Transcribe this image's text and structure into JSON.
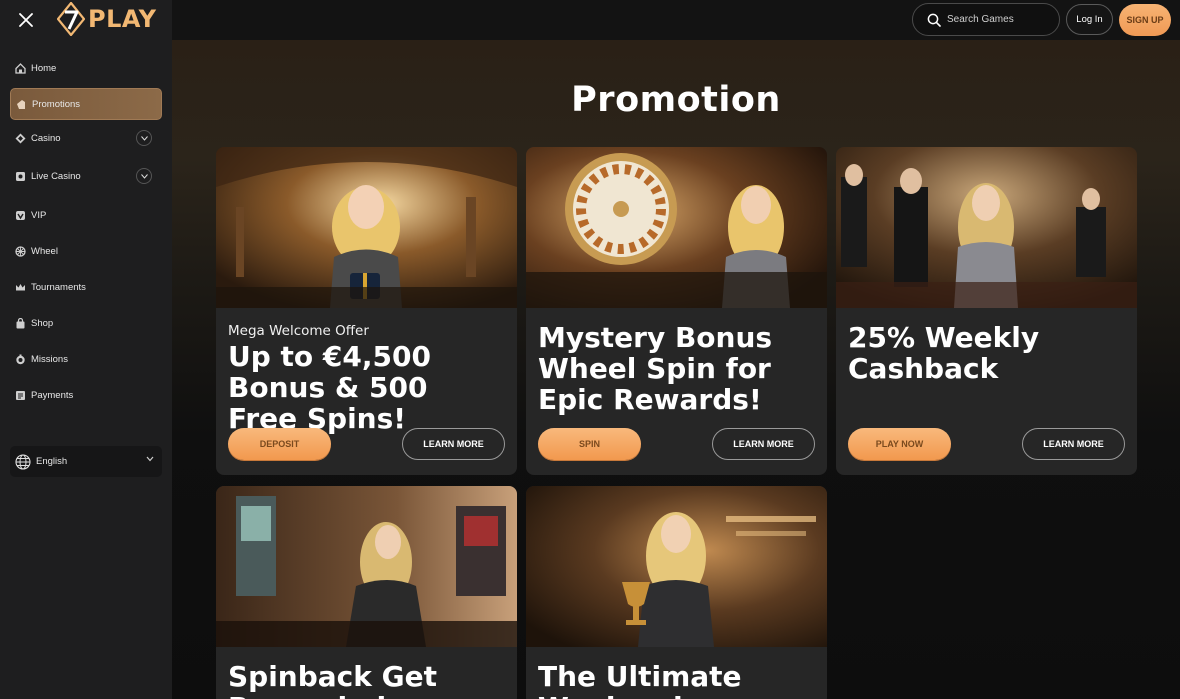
{
  "brand": {
    "logo_text": "PLAY"
  },
  "header": {
    "search_placeholder": "Search Games",
    "login_label": "Log In",
    "signup_label": "SIGN UP"
  },
  "sidebar": {
    "items": [
      {
        "label": "Home",
        "icon": "home-icon"
      },
      {
        "label": "Promotions",
        "icon": "promotions-icon",
        "active": true
      },
      {
        "label": "Casino",
        "icon": "casino-icon",
        "expandable": true
      },
      {
        "label": "Live Casino",
        "icon": "live-casino-icon",
        "expandable": true
      },
      {
        "label": "VIP",
        "icon": "vip-icon"
      },
      {
        "label": "Wheel",
        "icon": "wheel-icon"
      },
      {
        "label": "Tournaments",
        "icon": "crown-icon"
      },
      {
        "label": "Shop",
        "icon": "shop-icon"
      },
      {
        "label": "Missions",
        "icon": "missions-icon"
      },
      {
        "label": "Payments",
        "icon": "payments-icon"
      }
    ],
    "language": {
      "label": "English",
      "icon": "globe-icon"
    }
  },
  "page": {
    "title": "Promotion"
  },
  "promotions": [
    {
      "kicker": "Mega Welcome Offer",
      "title": "Up to €4,500 Bonus & 500 Free Spins!",
      "primary_label": "DEPOSIT",
      "secondary_label": "LEARN MORE"
    },
    {
      "kicker": "",
      "title": "Mystery Bonus Wheel Spin for Epic Rewards!",
      "primary_label": "SPIN",
      "secondary_label": "LEARN MORE"
    },
    {
      "kicker": "",
      "title": "25% Weekly Cashback",
      "primary_label": "PLAY NOW",
      "secondary_label": "LEARN MORE"
    },
    {
      "kicker": "",
      "title": "Spinback Get Rewarded",
      "primary_label": "",
      "secondary_label": ""
    },
    {
      "kicker": "",
      "title": "The Ultimate Weekend",
      "primary_label": "",
      "secondary_label": ""
    }
  ],
  "colors": {
    "accent": "#f2a35f",
    "active_nav": "#7a5a3c",
    "sidebar_bg": "#1e1e1f",
    "card_bg": "#262626"
  }
}
